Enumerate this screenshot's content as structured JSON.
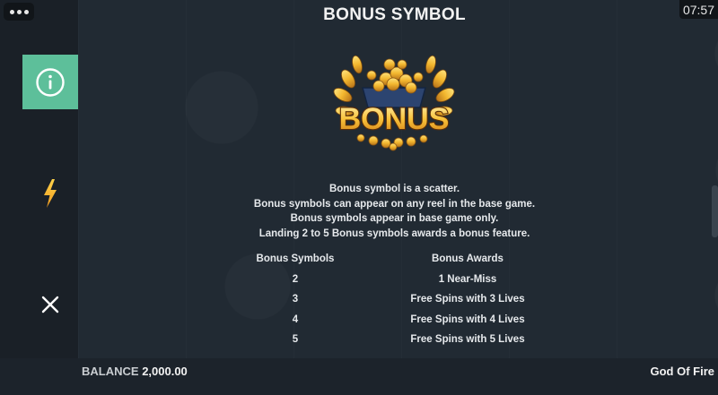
{
  "status_bar": {
    "time": "07:57"
  },
  "title": "BONUS SYMBOL",
  "bonus_logo_text": "BONUS",
  "description": [
    "Bonus symbol is a scatter.",
    "Bonus symbols can appear on any reel in the base game.",
    "Bonus symbols appear in base game only.",
    "Landing 2 to 5 Bonus symbols awards a bonus feature."
  ],
  "awards_table": {
    "headers": [
      "Bonus Symbols",
      "Bonus Awards"
    ],
    "rows": [
      [
        "2",
        "1 Near-Miss"
      ],
      [
        "3",
        "Free Spins with 3 Lives"
      ],
      [
        "4",
        "Free Spins with 4 Lives"
      ],
      [
        "5",
        "Free Spins with 5 Lives"
      ]
    ]
  },
  "footer": {
    "balance_label": "BALANCE",
    "balance_value": "2,000.00",
    "game_name": "God Of Fire"
  },
  "colors": {
    "accent_green": "#5dbf9a",
    "bolt_gold": "#f5b731",
    "background": "#212a33"
  },
  "icons": {
    "menu": "menu-dots-icon",
    "info": "info-icon",
    "bolt": "lightning-bolt-icon",
    "close": "close-icon"
  }
}
